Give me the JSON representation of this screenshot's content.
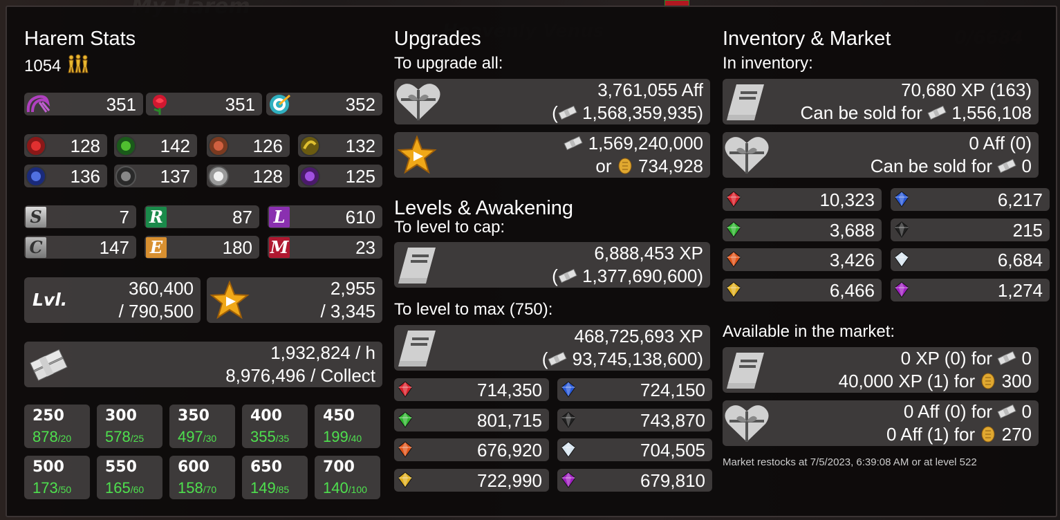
{
  "harem": {
    "title": "Harem Stats",
    "count": "1054",
    "classes": [
      "351",
      "351",
      "352"
    ],
    "elements": [
      "128",
      "142",
      "126",
      "132",
      "136",
      "137",
      "128",
      "125"
    ],
    "rarity": [
      {
        "letter": "S",
        "value": "7"
      },
      {
        "letter": "R",
        "value": "87"
      },
      {
        "letter": "L",
        "value": "610"
      },
      {
        "letter": "C",
        "value": "147"
      },
      {
        "letter": "E",
        "value": "180"
      },
      {
        "letter": "M",
        "value": "23"
      }
    ],
    "level_label": "Lvl.",
    "level_line1": "360,400",
    "level_line2": "/ 790,500",
    "stars_line1": "2,955",
    "stars_line2": "/ 3,345",
    "income_line1": "1,932,824 / h",
    "income_line2": "8,976,496 / Collect",
    "levels": [
      {
        "level": "250",
        "value": "878",
        "max": "/20"
      },
      {
        "level": "300",
        "value": "578",
        "max": "/25"
      },
      {
        "level": "350",
        "value": "497",
        "max": "/30"
      },
      {
        "level": "400",
        "value": "355",
        "max": "/35"
      },
      {
        "level": "450",
        "value": "199",
        "max": "/40"
      },
      {
        "level": "500",
        "value": "173",
        "max": "/50"
      },
      {
        "level": "550",
        "value": "165",
        "max": "/60"
      },
      {
        "level": "600",
        "value": "158",
        "max": "/70"
      },
      {
        "level": "650",
        "value": "149",
        "max": "/85"
      },
      {
        "level": "700",
        "value": "140",
        "max": "/100"
      }
    ]
  },
  "upgrades": {
    "title": "Upgrades",
    "subtitle": "To upgrade all:",
    "aff_line1": "3,761,055 Aff",
    "aff_open": "(",
    "aff_line2": "1,568,359,935)",
    "star_line1": "1,569,240,000",
    "star_or": "or",
    "star_line2": "734,928",
    "levels_title": "Levels & Awakening",
    "cap_label": "To level to cap:",
    "cap_line1": "6,888,453 XP",
    "cap_open": "(",
    "cap_line2": "1,377,690,600)",
    "max_label": "To level to max (750):",
    "max_line1": "468,725,693 XP",
    "max_open": "(",
    "max_line2": "93,745,138,600)",
    "gems": [
      "714,350",
      "724,150",
      "801,715",
      "743,870",
      "676,920",
      "704,505",
      "722,990",
      "679,810"
    ]
  },
  "inventory": {
    "title": "Inventory & Market",
    "subtitle": "In inventory:",
    "xp_line1": "70,680 XP (163)",
    "xp_line2_prefix": "Can be sold for",
    "xp_line2_value": "1,556,108",
    "aff_line1": "0 Aff (0)",
    "aff_line2_prefix": "Can be sold for",
    "aff_line2_value": "0",
    "gems": [
      "10,323",
      "6,217",
      "3,688",
      "215",
      "3,426",
      "6,684",
      "6,466",
      "1,274"
    ],
    "market_label": "Available in the market:",
    "mxp_line1_prefix": "0 XP (0) for",
    "mxp_line1_value": "0",
    "mxp_line2_prefix": "40,000 XP (1) for",
    "mxp_line2_value": "300",
    "maff_line1_prefix": "0 Aff (0) for",
    "maff_line1_value": "0",
    "maff_line2_prefix": "0 Aff (1) for",
    "maff_line2_value": "270",
    "restock": "Market restocks at 7/5/2023, 6:39:08 AM or at level 522"
  },
  "colors": {
    "red": "#d8202a",
    "green": "#2fb52f",
    "orange": "#e0541a",
    "yellow": "#e0b020",
    "blue": "#2a5ad8",
    "black": "#222222",
    "white": "#d8e6f0",
    "purple": "#a020c0"
  }
}
